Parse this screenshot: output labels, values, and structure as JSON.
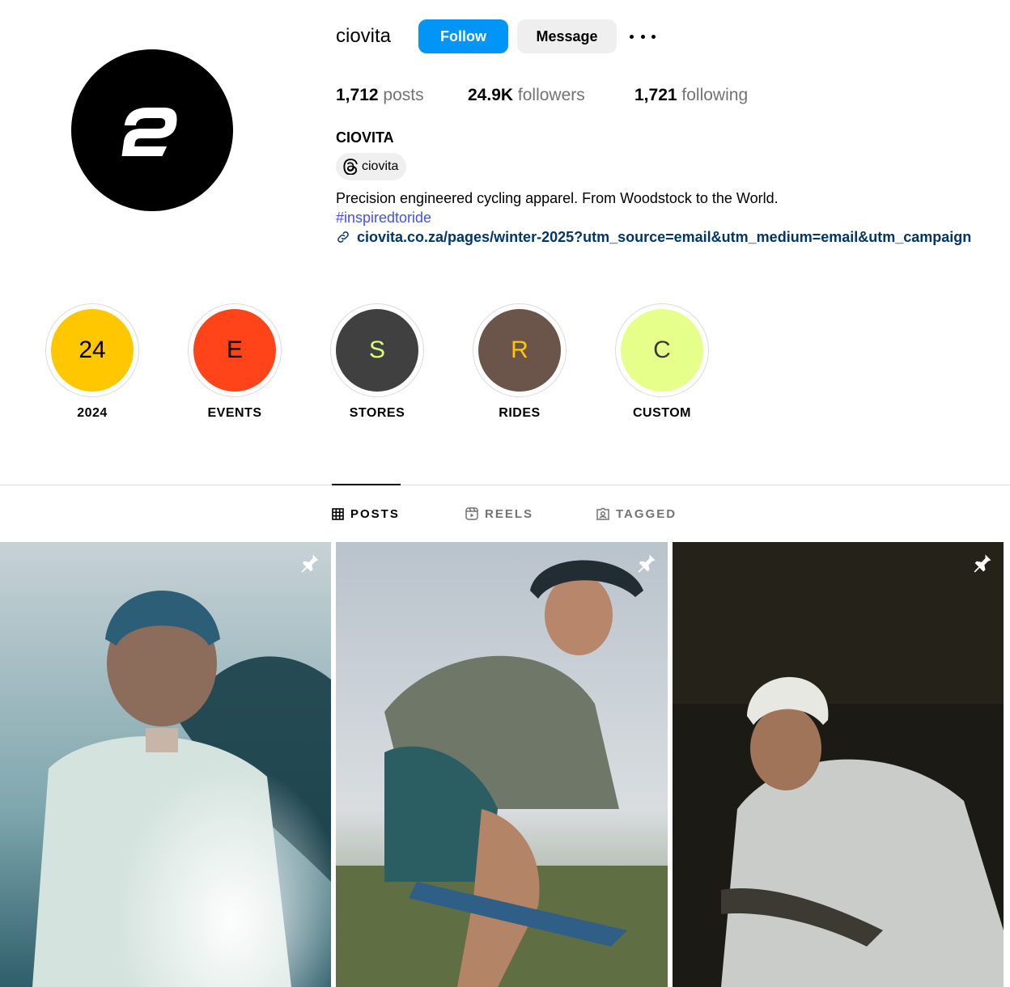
{
  "profile": {
    "username": "ciovita",
    "follow_label": "Follow",
    "message_label": "Message",
    "stats": {
      "posts_count": "1,712",
      "posts_label": "posts",
      "followers_count": "24.9K",
      "followers_label": "followers",
      "following_count": "1,721",
      "following_label": "following"
    },
    "full_name": "CIOVITA",
    "threads_handle": "ciovita",
    "bio": "Precision engineered cycling apparel. From Woodstock to the World.",
    "hashtag": "#inspiredtoride",
    "link": "ciovita.co.za/pages/winter-2025?utm_source=email&utm_medium=email&utm_campaign"
  },
  "highlights": [
    {
      "initial": "24",
      "label": "2024",
      "bg": "#ffc700",
      "fg": "#000000"
    },
    {
      "initial": "E",
      "label": "EVENTS",
      "bg": "#ff4419",
      "fg": "#000000"
    },
    {
      "initial": "S",
      "label": "STORES",
      "bg": "#404040",
      "fg": "#d7ff7a"
    },
    {
      "initial": "R",
      "label": "RIDES",
      "bg": "#6b5449",
      "fg": "#ffc700"
    },
    {
      "initial": "C",
      "label": "CUSTOM",
      "bg": "#e6ff8a",
      "fg": "#3a3a3a"
    }
  ],
  "tabs": [
    {
      "label": "POSTS",
      "icon": "grid-icon",
      "active": true
    },
    {
      "label": "REELS",
      "icon": "reels-icon",
      "active": false
    },
    {
      "label": "TAGGED",
      "icon": "tagged-icon",
      "active": false
    }
  ],
  "posts": [
    {
      "pinned": true,
      "icon": "pin-icon"
    },
    {
      "pinned": true,
      "icon": "pin-icon"
    },
    {
      "pinned": true,
      "icon": "pin-icon"
    }
  ],
  "colors": {
    "accent": "#0095f6",
    "link": "#00376b",
    "hashtag": "#4150f7",
    "muted": "#737373"
  }
}
